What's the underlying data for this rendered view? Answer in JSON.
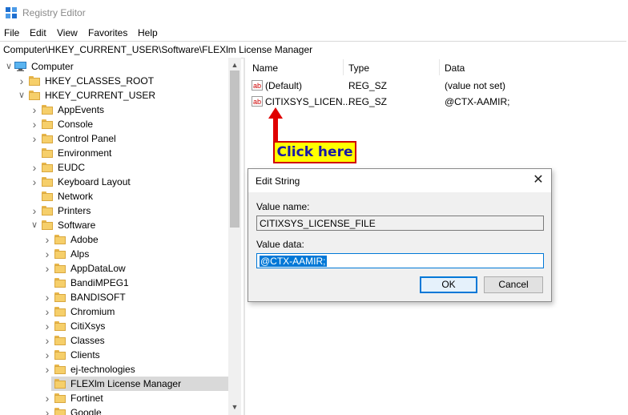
{
  "window": {
    "title": "Registry Editor"
  },
  "menu": [
    "File",
    "Edit",
    "View",
    "Favorites",
    "Help"
  ],
  "address": "Computer\\HKEY_CURRENT_USER\\Software\\FLEXlm License Manager",
  "tree": [
    {
      "label": "Computer",
      "level": 0,
      "expander": "open",
      "icon": "computer-icon"
    },
    {
      "label": "HKEY_CLASSES_ROOT",
      "level": 1,
      "expander": "closed"
    },
    {
      "label": "HKEY_CURRENT_USER",
      "level": 1,
      "expander": "open"
    },
    {
      "label": "AppEvents",
      "level": 2,
      "expander": "closed"
    },
    {
      "label": "Console",
      "level": 2,
      "expander": "closed"
    },
    {
      "label": "Control Panel",
      "level": 2,
      "expander": "closed"
    },
    {
      "label": "Environment",
      "level": 2,
      "expander": "none"
    },
    {
      "label": "EUDC",
      "level": 2,
      "expander": "closed"
    },
    {
      "label": "Keyboard Layout",
      "level": 2,
      "expander": "closed"
    },
    {
      "label": "Network",
      "level": 2,
      "expander": "none"
    },
    {
      "label": "Printers",
      "level": 2,
      "expander": "closed"
    },
    {
      "label": "Software",
      "level": 2,
      "expander": "open"
    },
    {
      "label": "Adobe",
      "level": 3,
      "expander": "closed"
    },
    {
      "label": "Alps",
      "level": 3,
      "expander": "closed"
    },
    {
      "label": "AppDataLow",
      "level": 3,
      "expander": "closed"
    },
    {
      "label": "BandiMPEG1",
      "level": 3,
      "expander": "none"
    },
    {
      "label": "BANDISOFT",
      "level": 3,
      "expander": "closed"
    },
    {
      "label": "Chromium",
      "level": 3,
      "expander": "closed"
    },
    {
      "label": "CitiXsys",
      "level": 3,
      "expander": "closed"
    },
    {
      "label": "Classes",
      "level": 3,
      "expander": "closed"
    },
    {
      "label": "Clients",
      "level": 3,
      "expander": "closed"
    },
    {
      "label": "ej-technologies",
      "level": 3,
      "expander": "closed"
    },
    {
      "label": "FLEXlm License Manager",
      "level": 3,
      "expander": "none",
      "selected": true
    },
    {
      "label": "Fortinet",
      "level": 3,
      "expander": "closed"
    },
    {
      "label": "Google",
      "level": 3,
      "expander": "closed"
    }
  ],
  "list": {
    "columns": [
      "Name",
      "Type",
      "Data"
    ],
    "rows": [
      {
        "name": "(Default)",
        "type": "REG_SZ",
        "data": "(value not set)"
      },
      {
        "name": "CITIXSYS_LICEN...",
        "type": "REG_SZ",
        "data": "@CTX-AAMIR;"
      }
    ]
  },
  "callout": {
    "text": "Click here",
    "arrow_color": "#e00000"
  },
  "dialog": {
    "title": "Edit String",
    "value_name_label": "Value name:",
    "value_name": "CITIXSYS_LICENSE_FILE",
    "value_data_label": "Value data:",
    "value_data": "@CTX-AAMIR;",
    "ok_label": "OK",
    "cancel_label": "Cancel"
  },
  "colors": {
    "accent": "#0078d7",
    "folder": "#f6cf6a",
    "callout_bg": "#ffff00",
    "callout_border": "#d10000",
    "callout_text": "#1a1aa6"
  }
}
